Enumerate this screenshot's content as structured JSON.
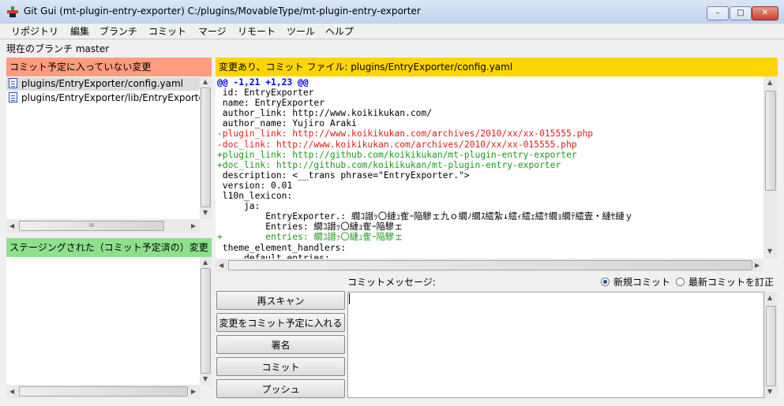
{
  "window": {
    "title": "Git Gui (mt-plugin-entry-exporter) C:/plugins/MovableType/mt-plugin-entry-exporter",
    "minimize_symbol": "–",
    "maximize_symbol": "□",
    "close_symbol": "✕"
  },
  "menu": {
    "items": [
      "リポジトリ",
      "編集",
      "ブランチ",
      "コミット",
      "マージ",
      "リモート",
      "ツール",
      "ヘルプ"
    ]
  },
  "branch_line": "現在のブランチ master",
  "unstaged": {
    "header": "コミット予定に入っていない変更",
    "color": "#ff9d7e",
    "files": [
      "plugins/EntryExporter/config.yaml",
      "plugins/EntryExporter/lib/EntryExporte"
    ],
    "selected_index": 0,
    "hscroll_thumb_glyph": "III"
  },
  "staged": {
    "header": "ステージングされた（コミット予定済の）変更",
    "color": "#8ee08b",
    "files": []
  },
  "diff": {
    "header": "変更あり、コミット ファイル:  plugins/EntryExporter/config.yaml",
    "color": "#ffd500",
    "lines": [
      {
        "kind": "hunk",
        "text": "@@ -1,21 +1,23 @@"
      },
      {
        "kind": "ctx",
        "text": " id: EntryExporter"
      },
      {
        "kind": "ctx",
        "text": " name: EntryExporter"
      },
      {
        "kind": "ctx",
        "text": " author_link: http://www.koikikukan.com/"
      },
      {
        "kind": "ctx",
        "text": " author_name: Yujiro Araki"
      },
      {
        "kind": "del",
        "text": "-plugin_link: http://www.koikikukan.com/archives/2010/xx/xx-015555.php"
      },
      {
        "kind": "del",
        "text": "-doc_link: http://www.koikikukan.com/archives/2010/xx/xx-015555.php"
      },
      {
        "kind": "add",
        "text": "+plugin_link: http://github.com/koikikukan/mt-plugin-entry-exporter"
      },
      {
        "kind": "add",
        "text": "+doc_link: http://github.com/koikikukan/mt-plugin-entry-exporter"
      },
      {
        "kind": "ctx",
        "text": " description: <__trans phrase=\"EntryExporter.\">"
      },
      {
        "kind": "ctx",
        "text": " version: 0.01"
      },
      {
        "kind": "ctx",
        "text": " l10n_lexicon:"
      },
      {
        "kind": "ctx",
        "text": "     ja:"
      },
      {
        "kind": "ctx",
        "text": "         EntryExporter.: 繝ｺ譛ｯ〇縺ｭ隺ｰ陥驂ェ九ｏ繝ﾉ繝ｽ繧紮↓繧ｨ繧ｪ繧ｹ繝ｮ繝ﾃ繧壹・縺ｾ縺ｙ"
      },
      {
        "kind": "ctx",
        "text": "         Entries: 繝ｺ譛ｯ〇縺ｭ隺ｰ陥驂ェ"
      },
      {
        "kind": "add",
        "text": "+        entries: 繝ｺ譛ｯ〇縺ｭ隺ｰ陥驂ェ"
      },
      {
        "kind": "ctx",
        "text": " theme_element_handlers:"
      },
      {
        "kind": "ctx",
        "text": "     default_entries:"
      }
    ]
  },
  "commit": {
    "message_label": "コミットメッセージ:",
    "radio_new": "新規コミット",
    "radio_amend": "最新コミットを訂正",
    "selected_radio": "new",
    "message_value": "",
    "buttons": {
      "rescan": "再スキャン",
      "stage": "変更をコミット予定に入れる",
      "signoff": "署名",
      "commit": "コミット",
      "push": "プッシュ"
    }
  }
}
